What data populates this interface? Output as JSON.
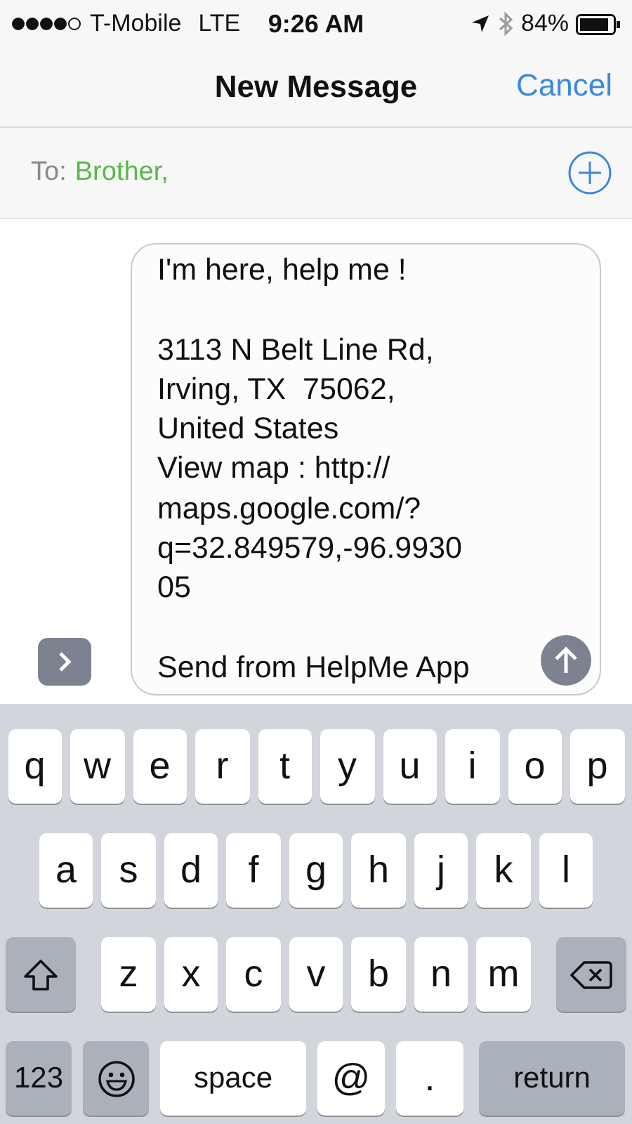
{
  "status_bar": {
    "carrier": "T-Mobile",
    "network": "LTE",
    "time": "9:26 AM",
    "battery": "84%"
  },
  "nav": {
    "title": "New Message",
    "cancel": "Cancel"
  },
  "to": {
    "label": "To:",
    "recipient": "Brother,"
  },
  "message": {
    "paragraphs": [
      "I'm here, help me !",
      "3113 N Belt Line Rd,\nIrving, TX  75062,\nUnited States\nView map : http://\nmaps.google.com/?\nq=32.849579,-96.9930\n05",
      "Send from HelpMe App"
    ]
  },
  "keyboard": {
    "rows": [
      {
        "keys": [
          {
            "kind": "letter",
            "label": "q"
          },
          {
            "kind": "letter",
            "label": "w"
          },
          {
            "kind": "letter",
            "label": "e"
          },
          {
            "kind": "letter",
            "label": "r"
          },
          {
            "kind": "letter",
            "label": "t"
          },
          {
            "kind": "letter",
            "label": "y"
          },
          {
            "kind": "letter",
            "label": "u"
          },
          {
            "kind": "letter",
            "label": "i"
          },
          {
            "kind": "letter",
            "label": "o"
          },
          {
            "kind": "letter",
            "label": "p"
          }
        ]
      },
      {
        "keys": [
          {
            "kind": "letter",
            "label": "a"
          },
          {
            "kind": "letter",
            "label": "s"
          },
          {
            "kind": "letter",
            "label": "d"
          },
          {
            "kind": "letter",
            "label": "f"
          },
          {
            "kind": "letter",
            "label": "g"
          },
          {
            "kind": "letter",
            "label": "h"
          },
          {
            "kind": "letter",
            "label": "j"
          },
          {
            "kind": "letter",
            "label": "k"
          },
          {
            "kind": "letter",
            "label": "l"
          }
        ]
      },
      {
        "keys": [
          {
            "kind": "shift"
          },
          {
            "kind": "letter",
            "label": "z"
          },
          {
            "kind": "letter",
            "label": "x"
          },
          {
            "kind": "letter",
            "label": "c"
          },
          {
            "kind": "letter",
            "label": "v"
          },
          {
            "kind": "letter",
            "label": "b"
          },
          {
            "kind": "letter",
            "label": "n"
          },
          {
            "kind": "letter",
            "label": "m"
          },
          {
            "kind": "delete"
          }
        ]
      },
      {
        "keys": [
          {
            "kind": "numbers",
            "label": "123"
          },
          {
            "kind": "emoji"
          },
          {
            "kind": "space",
            "label": "space"
          },
          {
            "kind": "symbol",
            "label": "@"
          },
          {
            "kind": "symbol",
            "label": "."
          },
          {
            "kind": "return",
            "label": "return"
          }
        ]
      }
    ]
  }
}
